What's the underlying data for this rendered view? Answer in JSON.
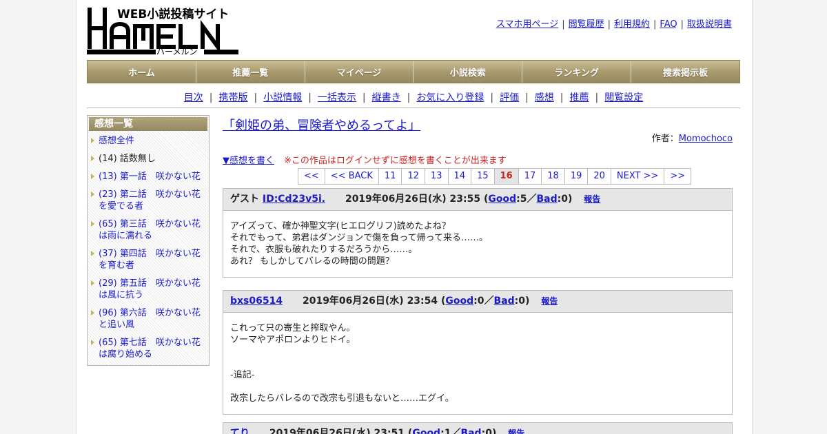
{
  "header": {
    "logo_tagline": "WEB小説投稿サイト",
    "logo_name": "HAMELN",
    "logo_kana": "ハーメルン",
    "toplinks": [
      "スマホ用ページ",
      "閲覧履歴",
      "利用規約",
      "FAQ",
      "取扱説明書"
    ]
  },
  "mainnav": [
    "ホーム",
    "推薦一覧",
    "マイページ",
    "小説検索",
    "ランキング",
    "捜索掲示板"
  ],
  "subnav": [
    "目次",
    "携帯版",
    "小説情報",
    "一括表示",
    "縦書き",
    "お気に入り登録",
    "評価",
    "感想",
    "推薦",
    "閲覧設定"
  ],
  "sidebar": {
    "title": "感想一覧",
    "items": [
      {
        "label": "感想全件",
        "link": true
      },
      {
        "label": "(14) 話数無し",
        "link": false
      },
      {
        "label": "(13) 第一話　咲かない花",
        "link": true
      },
      {
        "label": "(23) 第二話　咲かない花を愛でる者",
        "link": true
      },
      {
        "label": "(65) 第三話　咲かない花は雨に濡れる",
        "link": true
      },
      {
        "label": "(37) 第四話　咲かない花を育む者",
        "link": true
      },
      {
        "label": "(29) 第五話　咲かない花は風に抗う",
        "link": true
      },
      {
        "label": "(96) 第六話　咲かない花と追い風",
        "link": true
      },
      {
        "label": "(65) 第七話　咲かない花は腐り始める",
        "link": true
      }
    ]
  },
  "work": {
    "title": "「剣姫の弟、冒険者やめるってよ」",
    "author_label": "作者：",
    "author": "Momochoco",
    "write_link": "▼感想を書く",
    "write_note": "※この作品はログインせずに感想を書くことが出来ます"
  },
  "pager": {
    "items": [
      "<<",
      "<< BACK",
      "11",
      "12",
      "13",
      "14",
      "15",
      "16",
      "17",
      "18",
      "19",
      "20",
      "NEXT >>",
      ">>"
    ],
    "current": "16"
  },
  "comments": [
    {
      "prefix": "ゲスト",
      "user": "ID:Cd23v5i.",
      "date": "2019年06月26日(水) 23:55",
      "good_label": "Good",
      "good": "5",
      "bad_label": "Bad",
      "bad": "0",
      "report": "報告",
      "lines": [
        "アイズって、確か神聖文字(ヒエログリフ)読めたよね？",
        "それでもって、弟君はダンジョンで傷を負って帰って来る……。",
        "それで、衣服も破れたりするだろうから……。",
        "あれ？ もしかしてバレるの時間の問題？"
      ]
    },
    {
      "prefix": "",
      "user": "bxs06514",
      "date": "2019年06月26日(水) 23:54",
      "good_label": "Good",
      "good": "0",
      "bad_label": "Bad",
      "bad": "0",
      "report": "報告",
      "lines": [
        "これって只の寄生と搾取やん。",
        "ソーマやアポロンよりヒドイ。",
        "",
        "",
        "-追記-",
        "",
        "改宗したらバレるので改宗も引退もないと……エグイ。"
      ]
    },
    {
      "prefix": "",
      "user": "てり",
      "date": "2019年06月26日(水) 23:51",
      "good_label": "Good",
      "good": "1",
      "bad_label": "Bad",
      "bad": "0",
      "report": "報告",
      "lines": []
    }
  ]
}
